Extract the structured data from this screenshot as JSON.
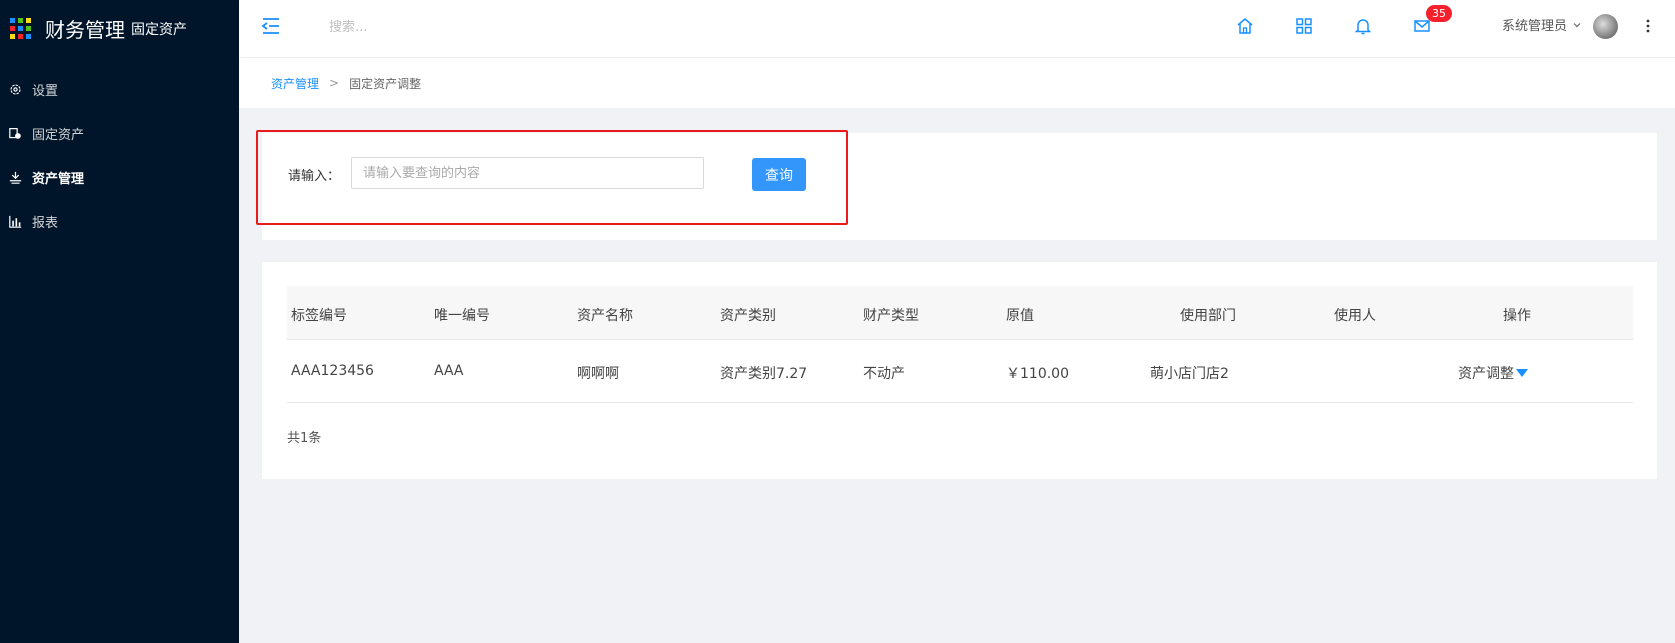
{
  "app": {
    "title": "财务管理",
    "subtitle": "固定资产",
    "logo_colors": [
      "#1890ff",
      "#52c41a",
      "#fadb14",
      "#f5222d",
      "#1890ff",
      "#52c41a",
      "#fadb14",
      "#f5222d",
      "#1890ff"
    ]
  },
  "sidebar": {
    "items": [
      {
        "label": "设置",
        "icon": "gear-icon"
      },
      {
        "label": "固定资产",
        "icon": "asset-icon"
      },
      {
        "label": "资产管理",
        "icon": "manage-icon",
        "active": true
      },
      {
        "label": "报表",
        "icon": "chart-icon"
      }
    ]
  },
  "header": {
    "search_placeholder": "搜索...",
    "mail_badge": "35",
    "user_name": "系统管理员"
  },
  "breadcrumb": {
    "parent": "资产管理",
    "separator": ">",
    "current": "固定资产调整"
  },
  "search": {
    "label": "请输入：",
    "placeholder": "请输入要查询的内容",
    "button": "查询"
  },
  "table": {
    "columns": [
      "标签编号",
      "唯一编号",
      "资产名称",
      "资产类别",
      "财产类型",
      "原值",
      "使用部门",
      "使用人",
      "操作"
    ],
    "rows": [
      {
        "tag_no": "AAA123456",
        "unique_no": "AAA",
        "name": "啊啊啊",
        "category": "资产类别7.27",
        "property_type": "不动产",
        "original_value": "￥110.00",
        "department": "萌小店门店2",
        "user": "",
        "action": "资产调整"
      }
    ],
    "total": "共1条"
  },
  "colors": {
    "sidebar_bg": "#001529",
    "primary": "#1890ff",
    "button": "#3296fa",
    "highlight": "#e81c1c",
    "badge": "#f5222d"
  }
}
